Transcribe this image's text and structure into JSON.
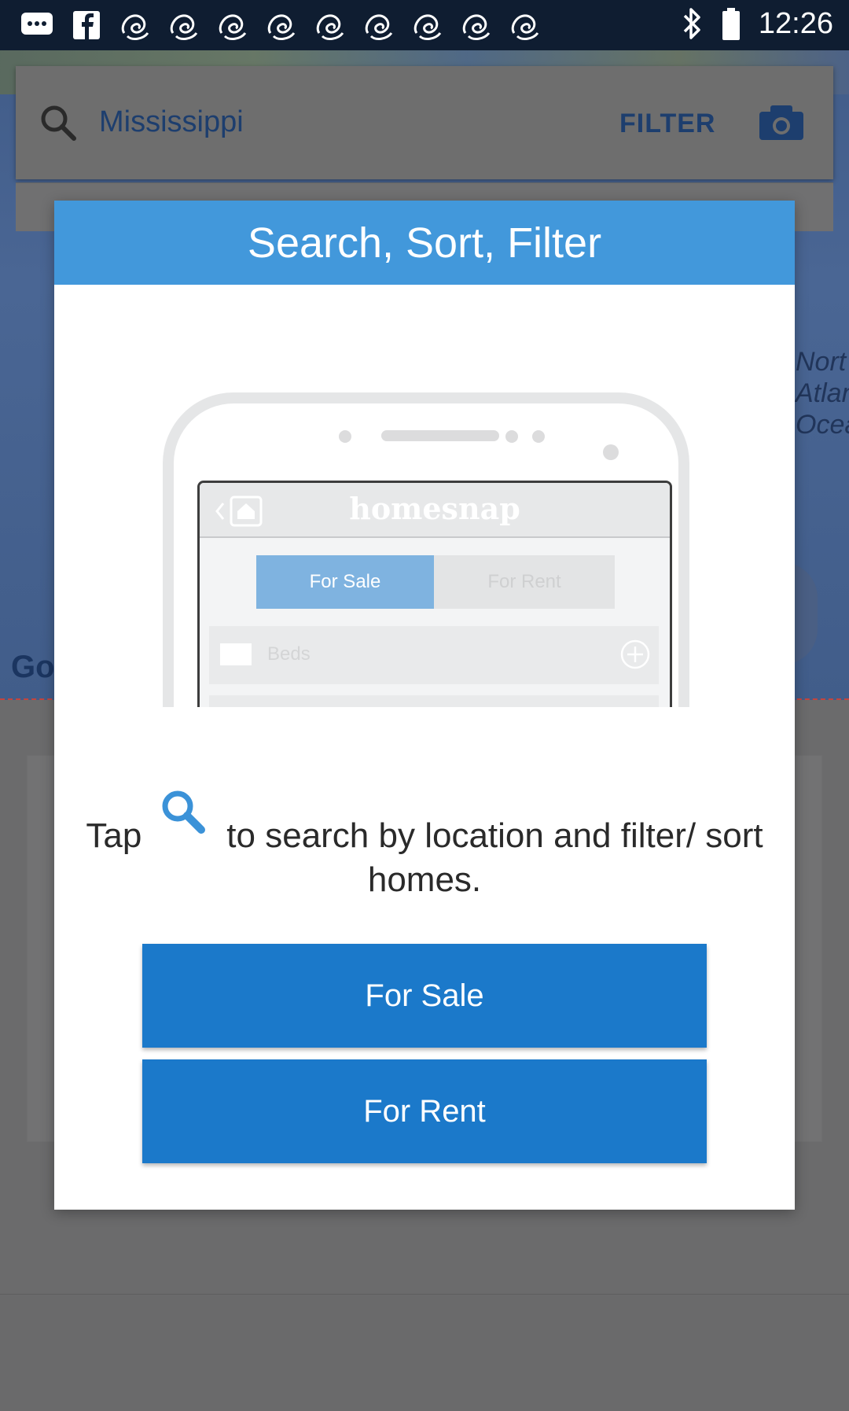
{
  "status_bar": {
    "time": "12:26",
    "left_icons": [
      "messages-icon",
      "facebook-icon",
      "app-icon",
      "app-icon",
      "app-icon",
      "app-icon",
      "app-icon",
      "app-icon",
      "app-icon",
      "app-icon",
      "app-icon"
    ],
    "right_icons": [
      "bluetooth-icon",
      "battery-icon"
    ]
  },
  "background": {
    "search_location": "Mississippi",
    "filter_label": "FILTER",
    "map_label_fragment": "Nort\nAtlan\nOcea",
    "google_fragment": "Go"
  },
  "dialog": {
    "title": "Search, Sort, Filter",
    "illustration": {
      "brand": "homesnap",
      "tab_sale": "For Sale",
      "tab_rent": "For Rent",
      "beds_label": "Beds"
    },
    "instruction_prefix": "Tap",
    "instruction_suffix": "to search by location and filter/ sort homes.",
    "buttons": {
      "for_sale": "For Sale",
      "for_rent": "For Rent"
    }
  },
  "colors": {
    "header": "#4298db",
    "button": "#1b79ca",
    "status_bar": "#0f1d31"
  }
}
